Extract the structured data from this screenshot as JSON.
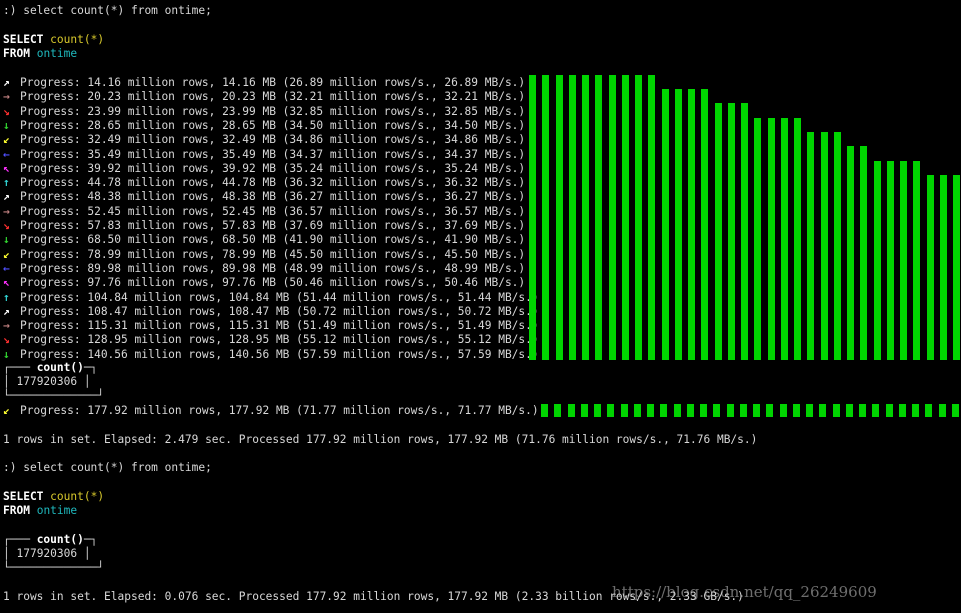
{
  "terminal": {
    "background": "#000000",
    "bar_color": "#00d400",
    "query1": {
      "prompt_line": ":) select count(*) from ontime;",
      "select_kw": "SELECT",
      "select_fn": "count(*)",
      "from_kw": "FROM",
      "table": "ontime",
      "progress": [
        {
          "arrow": "↗",
          "arrow_color": "#ffffff",
          "text": "Progress: 14.16 million rows, 14.16 MB (26.89 million rows/s., 26.89 MB/s.)"
        },
        {
          "arrow": "→",
          "arrow_color": "#c08080",
          "text": "Progress: 20.23 million rows, 20.23 MB (32.21 million rows/s., 32.21 MB/s.)"
        },
        {
          "arrow": "↘",
          "arrow_color": "#ff3030",
          "text": "Progress: 23.99 million rows, 23.99 MB (32.85 million rows/s., 32.85 MB/s.)"
        },
        {
          "arrow": "↓",
          "arrow_color": "#30d030",
          "text": "Progress: 28.65 million rows, 28.65 MB (34.50 million rows/s., 34.50 MB/s.)"
        },
        {
          "arrow": "↙",
          "arrow_color": "#ffff30",
          "text": "Progress: 32.49 million rows, 32.49 MB (34.86 million rows/s., 34.86 MB/s.)"
        },
        {
          "arrow": "←",
          "arrow_color": "#5050ff",
          "text": "Progress: 35.49 million rows, 35.49 MB (34.37 million rows/s., 34.37 MB/s.)"
        },
        {
          "arrow": "↖",
          "arrow_color": "#ff30ff",
          "text": "Progress: 39.92 million rows, 39.92 MB (35.24 million rows/s., 35.24 MB/s.)"
        },
        {
          "arrow": "↑",
          "arrow_color": "#30d0d0",
          "text": "Progress: 44.78 million rows, 44.78 MB (36.32 million rows/s., 36.32 MB/s.)"
        },
        {
          "arrow": "↗",
          "arrow_color": "#ffffff",
          "text": "Progress: 48.38 million rows, 48.38 MB (36.27 million rows/s., 36.27 MB/s.)"
        },
        {
          "arrow": "→",
          "arrow_color": "#c08080",
          "text": "Progress: 52.45 million rows, 52.45 MB (36.57 million rows/s., 36.57 MB/s.)"
        },
        {
          "arrow": "↘",
          "arrow_color": "#ff3030",
          "text": "Progress: 57.83 million rows, 57.83 MB (37.69 million rows/s., 37.69 MB/s.)"
        },
        {
          "arrow": "↓",
          "arrow_color": "#30d030",
          "text": "Progress: 68.50 million rows, 68.50 MB (41.90 million rows/s., 41.90 MB/s.)"
        },
        {
          "arrow": "↙",
          "arrow_color": "#ffff30",
          "text": "Progress: 78.99 million rows, 78.99 MB (45.50 million rows/s., 45.50 MB/s.)"
        },
        {
          "arrow": "←",
          "arrow_color": "#5050ff",
          "text": "Progress: 89.98 million rows, 89.98 MB (48.99 million rows/s., 48.99 MB/s.)"
        },
        {
          "arrow": "↖",
          "arrow_color": "#ff30ff",
          "text": "Progress: 97.76 million rows, 97.76 MB (50.46 million rows/s., 50.46 MB/s.)"
        },
        {
          "arrow": "↑",
          "arrow_color": "#30d0d0",
          "text": "Progress: 104.84 million rows, 104.84 MB (51.44 million rows/s., 51.44 MB/s.)"
        },
        {
          "arrow": "↗",
          "arrow_color": "#ffffff",
          "text": "Progress: 108.47 million rows, 108.47 MB (50.72 million rows/s., 50.72 MB/s.)"
        },
        {
          "arrow": "→",
          "arrow_color": "#c08080",
          "text": "Progress: 115.31 million rows, 115.31 MB (51.49 million rows/s., 51.49 MB/s.)"
        },
        {
          "arrow": "↘",
          "arrow_color": "#ff3030",
          "text": "Progress: 128.95 million rows, 128.95 MB (55.12 million rows/s., 55.12 MB/s.)"
        },
        {
          "arrow": "↓",
          "arrow_color": "#30d030",
          "text": "Progress: 140.56 million rows, 140.56 MB (57.59 million rows/s., 57.59 MB/s.)"
        }
      ],
      "result_header": "count()",
      "result_value": "177920306",
      "final_progress": {
        "arrow": "↙",
        "arrow_color": "#ffff30",
        "text": "Progress: 177.92 million rows, 177.92 MB (71.77 million rows/s., 71.77 MB/s.)"
      },
      "summary": "1 rows in set. Elapsed: 2.479 sec. Processed 177.92 million rows, 177.92 MB (71.76 million rows/s., 71.76 MB/s.)"
    },
    "query2": {
      "prompt_line": ":) select count(*) from ontime;",
      "select_kw": "SELECT",
      "select_fn": "count(*)",
      "from_kw": "FROM",
      "table": "ontime",
      "result_header": "count()",
      "result_value": "177920306",
      "summary": "1 rows in set. Elapsed: 0.076 sec. Processed 177.92 million rows, 177.92 MB (2.33 billion rows/s., 2.33 GB/s.)"
    },
    "watermark": "https://blog.csdn.net/qq_26249609"
  }
}
